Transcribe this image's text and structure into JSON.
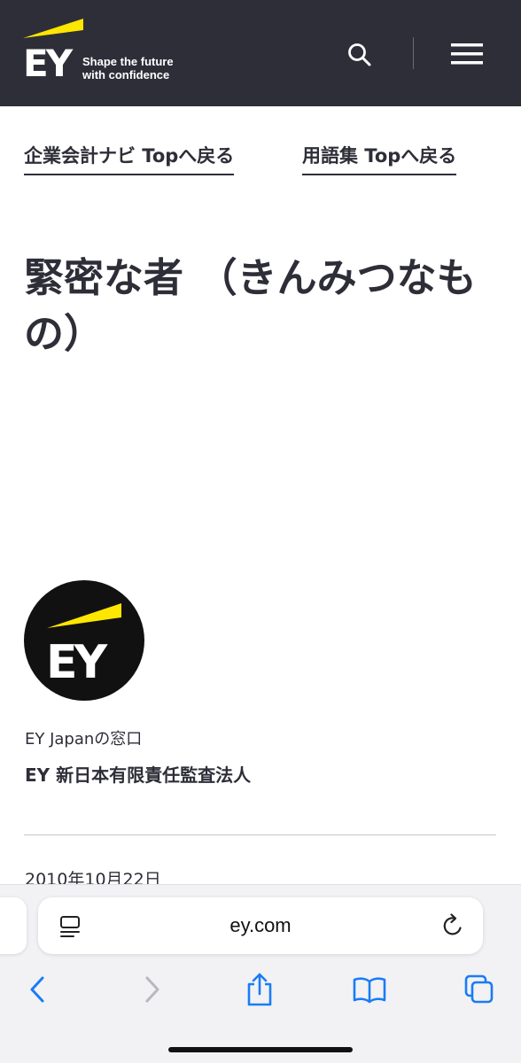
{
  "header": {
    "logo_letters": "EY",
    "tagline": "Shape the future\nwith confidence",
    "icons": {
      "search": "search-icon",
      "menu": "hamburger-menu-icon"
    }
  },
  "nav": {
    "links": [
      {
        "label": "企業会計ナビ Topへ戻る"
      },
      {
        "label": "用語集 Topへ戻る"
      }
    ]
  },
  "article": {
    "title": "緊密な者 （きんみつなもの）",
    "contact": {
      "label": "EY Japanの窓口",
      "name": "EY 新日本有限責任監査法人",
      "logo_letters": "EY"
    },
    "date": "2010年10月22日"
  },
  "browser": {
    "url": "ey.com",
    "icons": {
      "reader": "reader-mode-icon",
      "reload": "reload-icon",
      "back": "back-chevron-icon",
      "forward": "forward-chevron-icon",
      "share": "share-icon",
      "bookmarks": "bookmarks-icon",
      "tabs": "tabs-icon"
    }
  },
  "colors": {
    "brand_dark": "#2e2e38",
    "brand_yellow": "#ffe600",
    "ios_blue": "#1a7cf5",
    "ios_disabled": "#b8b8bd"
  }
}
